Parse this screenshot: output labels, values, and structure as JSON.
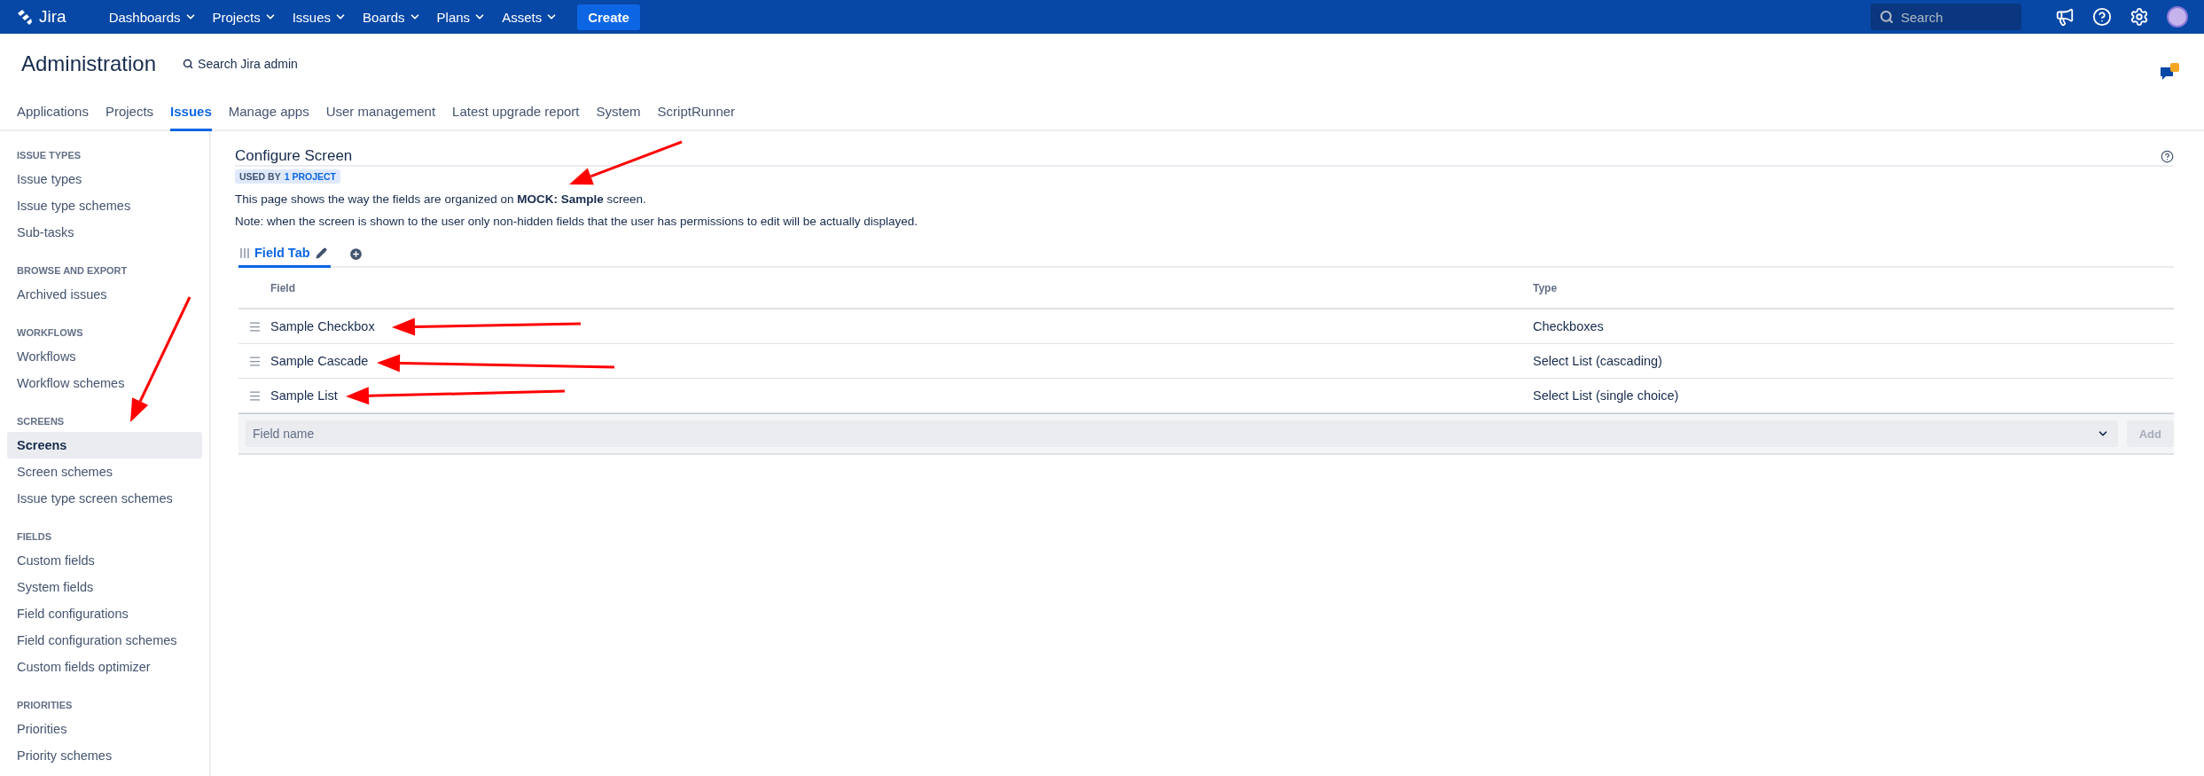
{
  "top_nav": {
    "logo": "Jira",
    "menus": [
      {
        "label": "Dashboards"
      },
      {
        "label": "Projects"
      },
      {
        "label": "Issues"
      },
      {
        "label": "Boards"
      },
      {
        "label": "Plans"
      },
      {
        "label": "Assets"
      }
    ],
    "create_button": "Create",
    "search": {
      "placeholder": "Search"
    }
  },
  "admin": {
    "title": "Administration",
    "search_link": "Search Jira admin"
  },
  "admin_tabs": [
    {
      "label": "Applications",
      "selected": false
    },
    {
      "label": "Projects",
      "selected": false
    },
    {
      "label": "Issues",
      "selected": true
    },
    {
      "label": "Manage apps",
      "selected": false
    },
    {
      "label": "User management",
      "selected": false
    },
    {
      "label": "Latest upgrade report",
      "selected": false
    },
    {
      "label": "System",
      "selected": false
    },
    {
      "label": "ScriptRunner",
      "selected": false
    }
  ],
  "sidebar": {
    "sections": [
      {
        "heading": "ISSUE TYPES",
        "items": [
          {
            "label": "Issue types",
            "selected": false
          },
          {
            "label": "Issue type schemes",
            "selected": false
          },
          {
            "label": "Sub-tasks",
            "selected": false
          }
        ]
      },
      {
        "heading": "BROWSE AND EXPORT",
        "items": [
          {
            "label": "Archived issues",
            "selected": false
          }
        ]
      },
      {
        "heading": "WORKFLOWS",
        "items": [
          {
            "label": "Workflows",
            "selected": false
          },
          {
            "label": "Workflow schemes",
            "selected": false
          }
        ]
      },
      {
        "heading": "SCREENS",
        "items": [
          {
            "label": "Screens",
            "selected": true
          },
          {
            "label": "Screen schemes",
            "selected": false
          },
          {
            "label": "Issue type screen schemes",
            "selected": false
          }
        ]
      },
      {
        "heading": "FIELDS",
        "items": [
          {
            "label": "Custom fields",
            "selected": false
          },
          {
            "label": "System fields",
            "selected": false
          },
          {
            "label": "Field configurations",
            "selected": false
          },
          {
            "label": "Field configuration schemes",
            "selected": false
          },
          {
            "label": "Custom fields optimizer",
            "selected": false
          }
        ]
      },
      {
        "heading": "PRIORITIES",
        "items": [
          {
            "label": "Priorities",
            "selected": false
          },
          {
            "label": "Priority schemes",
            "selected": false
          }
        ]
      }
    ]
  },
  "content": {
    "title": "Configure Screen",
    "badge": {
      "prefix": "USED BY",
      "link": "1 PROJECT"
    },
    "description": "This page shows the way the fields are organized on **MOCK: Sample** screen.",
    "note": "Note: when the screen is shown to the user only non-hidden fields that the user has permissions to edit will be actually displayed.",
    "screen_tabs": [
      {
        "label": "Field Tab",
        "selected": true
      }
    ],
    "table": {
      "columns": [
        "Field",
        "Type"
      ],
      "rows": [
        {
          "field": "Sample Checkbox",
          "type": "Checkboxes"
        },
        {
          "field": "Sample Cascade",
          "type": "Select List (cascading)"
        },
        {
          "field": "Sample List",
          "type": "Select List (single choice)"
        }
      ]
    },
    "add_field": {
      "placeholder": "Field name",
      "button": "Add",
      "disabled": true
    }
  }
}
